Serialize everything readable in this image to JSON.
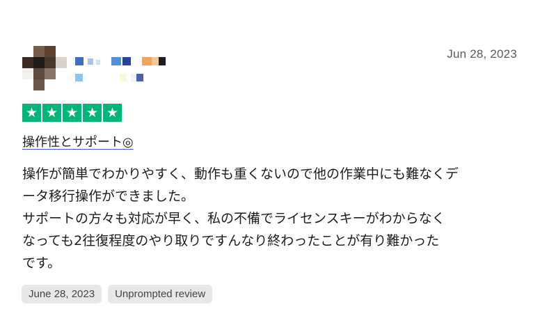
{
  "reviewer": {
    "avatar_icon": "avatar-pixelated"
  },
  "review": {
    "date_top": "Jun 28, 2023",
    "rating": {
      "value": 5,
      "max": 5,
      "star_color": "#00b67a",
      "icon": "star-icon"
    },
    "title": "操作性とサポート◎",
    "body_lines": [
      "操作が簡単でわかりやすく、動作も重くないので他の作業中にも難なくデ",
      "ータ移行操作ができました。",
      "サポートの方々も対応が早く、私の不備でライセンスキーがわからなく",
      "なっても2往復程度のやり取りですんなり終わったことが有り難かった",
      "です。"
    ],
    "chips": [
      {
        "label": "June 28, 2023"
      },
      {
        "label": "Unprompted review"
      }
    ]
  }
}
